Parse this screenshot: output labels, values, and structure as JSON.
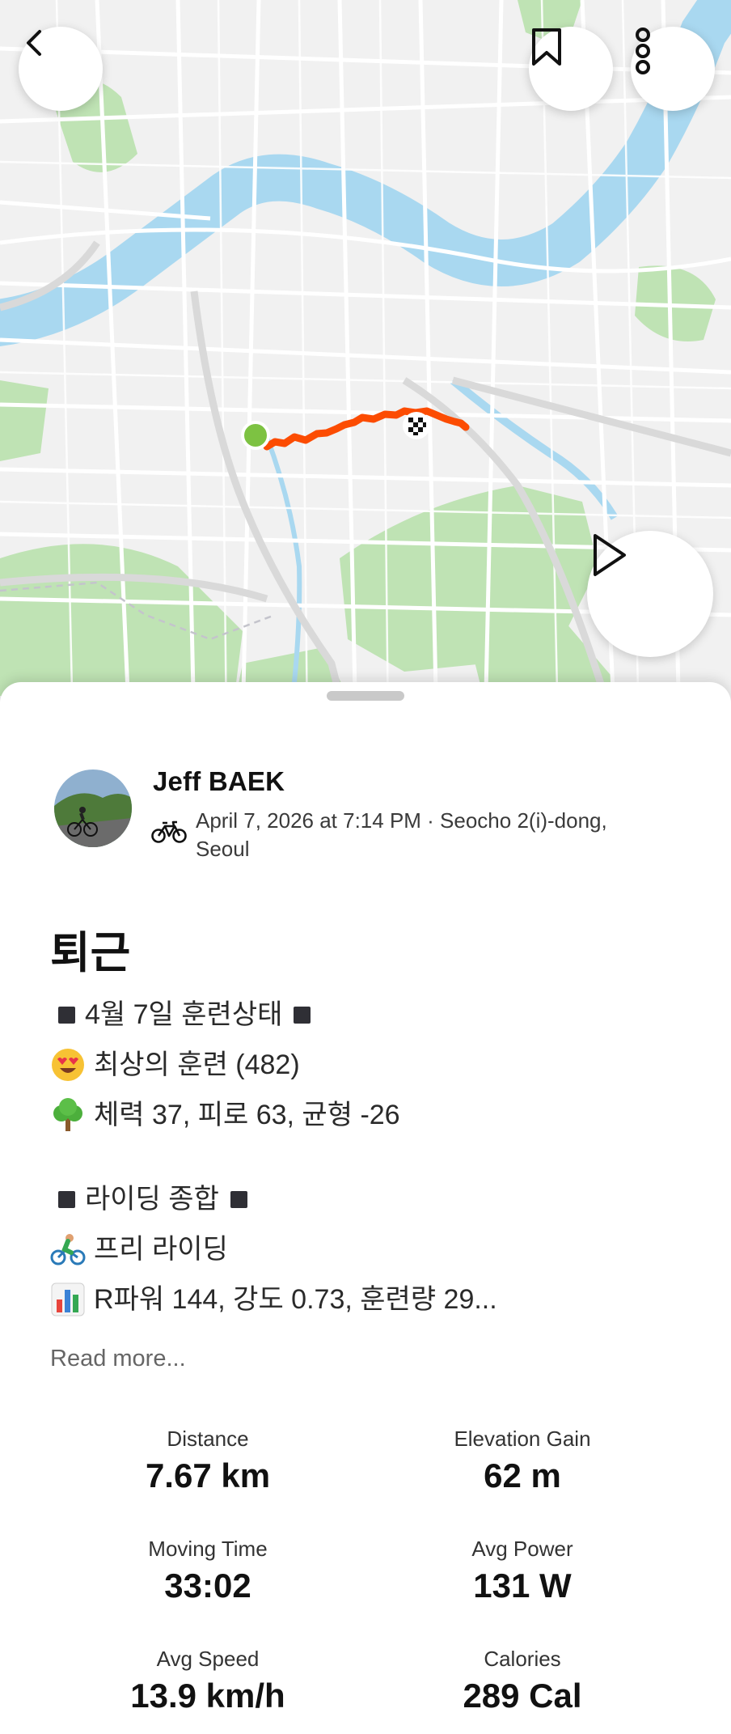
{
  "map": {
    "back_icon": "chevron-left-icon",
    "bookmark_icon": "bookmark-icon",
    "more_icon": "more-vertical-icon",
    "play_icon": "play-icon",
    "route_color": "#fc4c02",
    "start_color": "#7dc242",
    "water_color": "#a9d8f0",
    "park_color": "#bfe3b4"
  },
  "activity": {
    "athlete_name": "Jeff BAEK",
    "sport_icon": "bicycle-icon",
    "meta": "April 7, 2026 at 7:14 PM · Seocho 2(i)-dong, Seoul",
    "title": "퇴근",
    "description": [
      "4월 7일 훈련상태",
      "최상의 훈련 (482)",
      "체력 37, 피로 63, 균형 -26",
      "라이딩 종합",
      "프리 라이딩",
      "R파워 144, 강도 0.73, 훈련량 29..."
    ],
    "read_more": "Read more..."
  },
  "stats": {
    "distance_label": "Distance",
    "distance_value": "7.67 km",
    "elevation_label": "Elevation Gain",
    "elevation_value": "62 m",
    "moving_time_label": "Moving Time",
    "moving_time_value": "33:02",
    "avg_power_label": "Avg Power",
    "avg_power_value": "131 W",
    "avg_speed_label": "Avg Speed",
    "avg_speed_value": "13.9 km/h",
    "calories_label": "Calories",
    "calories_value": "289 Cal"
  }
}
